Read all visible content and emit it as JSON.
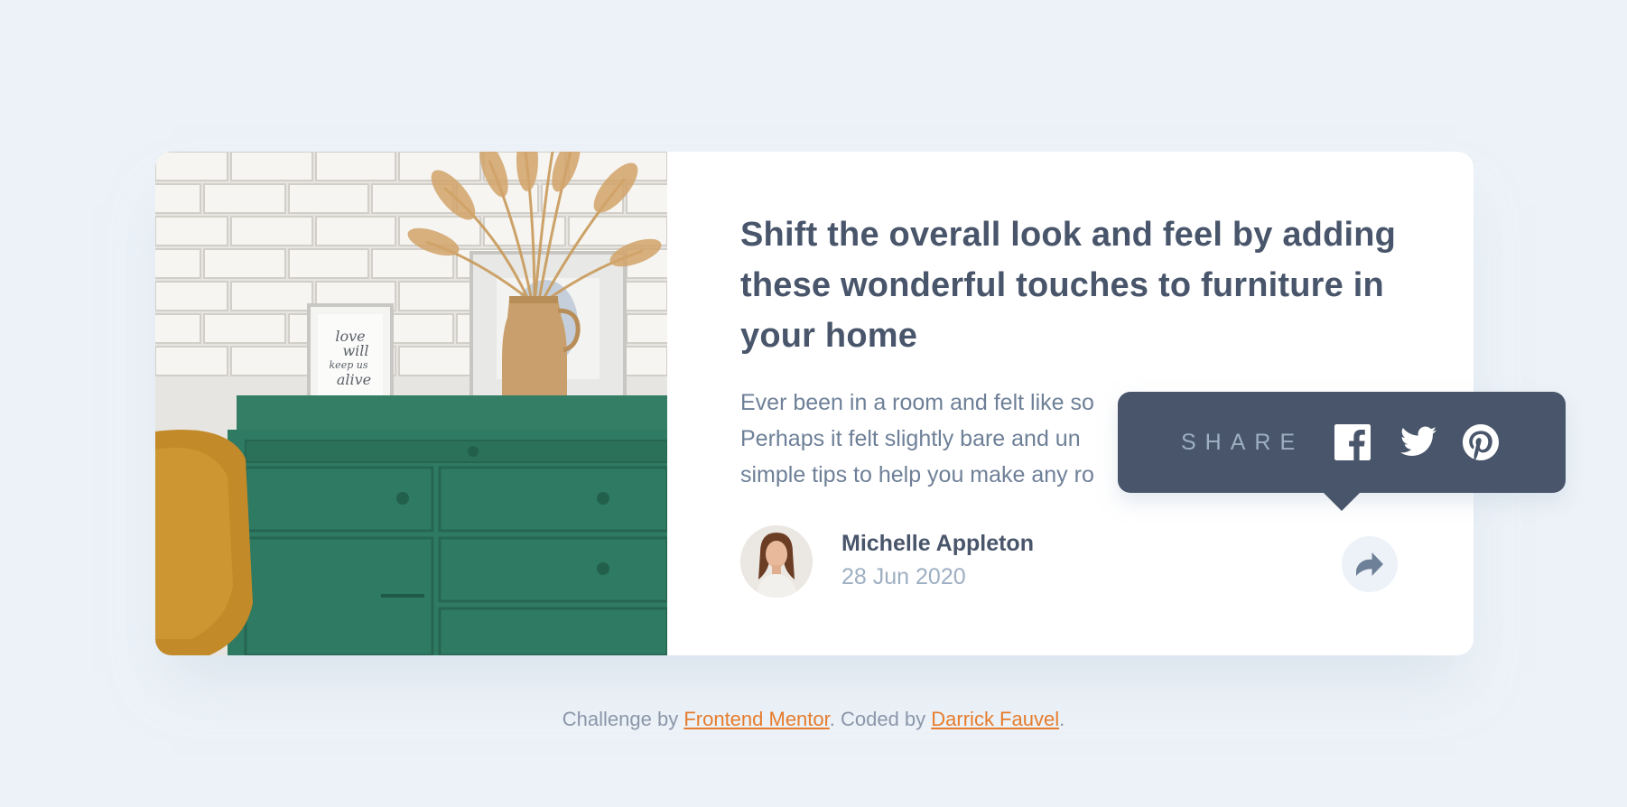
{
  "article": {
    "title": "Shift the overall look and feel by adding these wonderful touches to furniture in your home",
    "body_lines": [
      "Ever been in a room and felt like so",
      "Perhaps it felt slightly bare and un",
      "simple tips to help you make any ro"
    ],
    "image_alt": "drawers",
    "frame_text": [
      "love",
      "will",
      "keep us",
      "alive"
    ]
  },
  "author": {
    "name": "Michelle Appleton",
    "date": "28 Jun 2020"
  },
  "share": {
    "label": "SHARE",
    "icons": [
      "facebook-icon",
      "twitter-icon",
      "pinterest-icon"
    ],
    "button_icon": "share-arrow-icon"
  },
  "footer": {
    "prefix": "Challenge by ",
    "link1": "Frontend Mentor",
    "middle": ". Coded by ",
    "link2": "Darrick Fauvel",
    "suffix": "."
  },
  "colors": {
    "background": "#ecf2f8",
    "card": "#ffffff",
    "heading": "#48556a",
    "body": "#6e8098",
    "muted": "#9eafc2",
    "tooltip": "#48556a",
    "link": "#e67c2c",
    "dresser": "#2f7a62"
  }
}
